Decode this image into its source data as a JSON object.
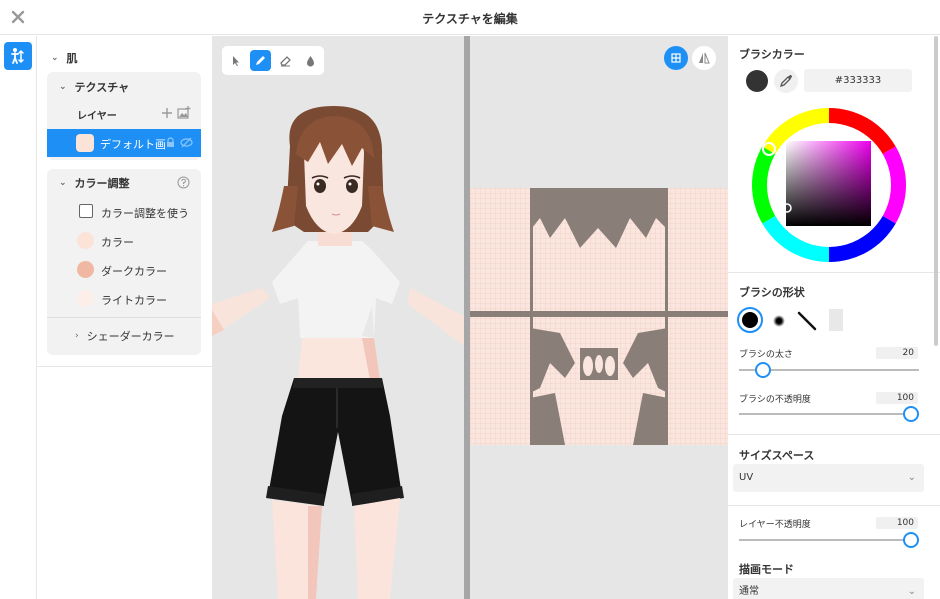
{
  "title": "テクスチャを編集",
  "tree": {
    "root_label": "肌",
    "texture_section_label": "テクスチャ",
    "layer_header_label": "レイヤー",
    "layer_name": "デフォルト画",
    "color_adjust_label": "カラー調整",
    "use_color_adjust_label": "カラー調整を使う",
    "color_label": "カラー",
    "dark_color_label": "ダークカラー",
    "light_color_label": "ライトカラー",
    "shader_color_label": "シェーダーカラー"
  },
  "colors": {
    "accent": "#1e90f5",
    "skin_color": "#fbe3d8",
    "dark_color": "#f0b8a3",
    "light_color": "#fcefe9",
    "brush_color": "#333333"
  },
  "right": {
    "brush_color_label": "ブラシカラー",
    "brush_color_hex": "#333333",
    "brush_shape_label": "ブラシの形状",
    "brush_size_label": "ブラシの太さ",
    "brush_size_value": "20",
    "brush_opacity_label": "ブラシの不透明度",
    "brush_opacity_value": "100",
    "size_space_label": "サイズスペース",
    "size_space_value": "UV",
    "layer_opacity_label": "レイヤー不透明度",
    "layer_opacity_value": "100",
    "draw_mode_label": "描画モード",
    "draw_mode_value": "通常"
  },
  "sliders": {
    "brush_size_fraction": 0.1,
    "brush_opacity_fraction": 1.0,
    "layer_opacity_fraction": 1.0
  },
  "icons": {
    "close": "close-icon",
    "avatar_mode": "person-icon",
    "add_layer": "plus-icon",
    "add_image": "image-add-icon",
    "help": "help-circle-icon",
    "select_tool": "cursor-icon",
    "pen_tool": "pen-icon",
    "eraser_tool": "eraser-icon",
    "fill_tool": "drop-icon",
    "uv_grid": "grid-icon",
    "mirror": "mirror-icon",
    "eyedropper": "eyedropper-icon"
  }
}
